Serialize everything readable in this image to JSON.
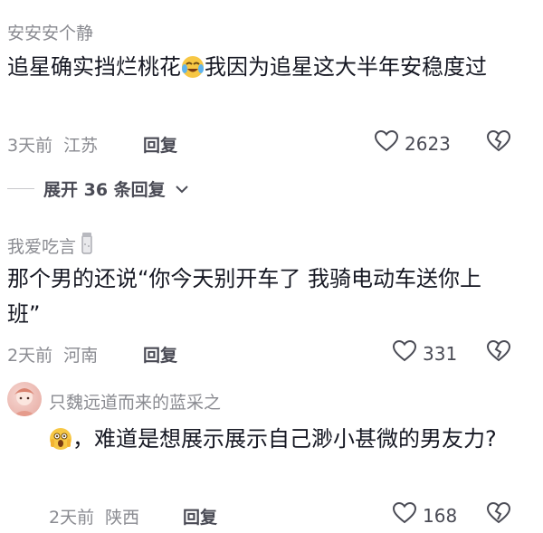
{
  "comments": [
    {
      "user": "安安安个静",
      "text_part1": "追星确实挡烂桃花",
      "emoji1": "crying-laughing-emoji",
      "text_part2": "我因为追星这大半年安稳度过",
      "time": "3天前",
      "location": "江苏",
      "reply_label": "回复",
      "likes": "2623",
      "expand_label": "展开 36 条回复"
    },
    {
      "user": "我爱吃言",
      "badge": "salt-shaker-icon",
      "text": "那个男的还说“你今天别开车了 我骑电动车送你上班”",
      "time": "2天前",
      "location": "河南",
      "reply_label": "回复",
      "likes": "331"
    },
    {
      "user": "只魏远道而来的蓝采之",
      "emoji1": "shocked-face-emoji",
      "text": "，难道是想展示展示自己渺小甚微的男友力?",
      "time": "2天前",
      "location": "陕西",
      "reply_label": "回复",
      "likes": "168"
    }
  ],
  "colors": {
    "text": "#161823",
    "secondary": "#8a8b91",
    "action": "#4a4b55"
  }
}
